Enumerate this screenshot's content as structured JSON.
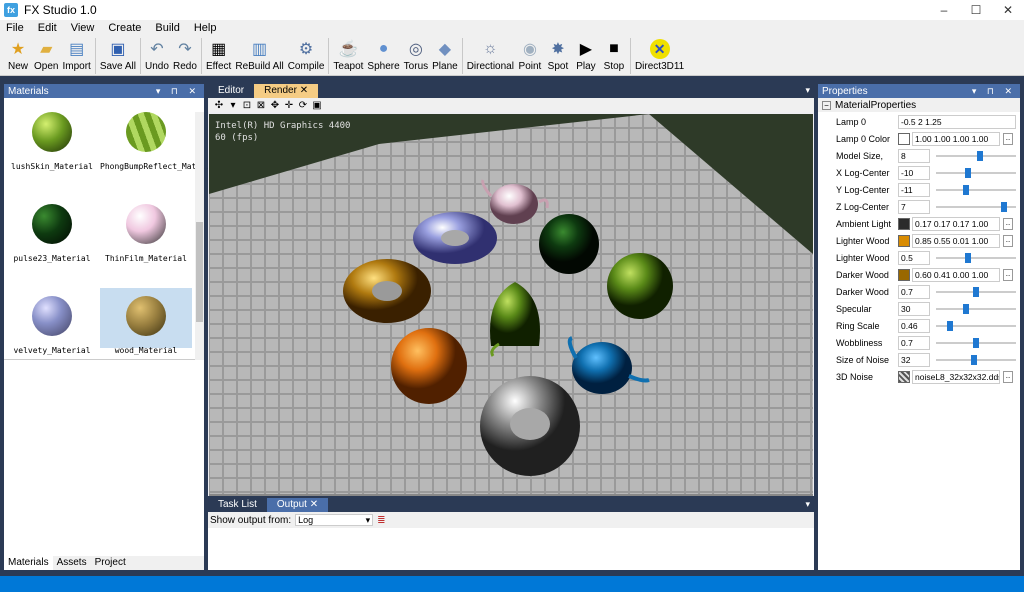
{
  "app": {
    "title": "FX Studio 1.0"
  },
  "window_controls": {
    "minimize": "–",
    "maximize": "☐",
    "close": "✕"
  },
  "menu": [
    "File",
    "Edit",
    "View",
    "Create",
    "Build",
    "Help"
  ],
  "toolbar": [
    {
      "label": "New",
      "icon": "new-icon"
    },
    {
      "label": "Open",
      "icon": "open-icon"
    },
    {
      "label": "Import",
      "icon": "import-icon"
    },
    {
      "label": "Save All",
      "icon": "save-all-icon"
    },
    {
      "label": "Undo",
      "icon": "undo-icon"
    },
    {
      "label": "Redo",
      "icon": "redo-icon"
    },
    {
      "label": "Effect",
      "icon": "effect-icon"
    },
    {
      "label": "ReBuild All",
      "icon": "rebuild-icon"
    },
    {
      "label": "Compile",
      "icon": "compile-icon"
    },
    {
      "label": "Teapot",
      "icon": "teapot-icon"
    },
    {
      "label": "Sphere",
      "icon": "sphere-icon"
    },
    {
      "label": "Torus",
      "icon": "torus-icon"
    },
    {
      "label": "Plane",
      "icon": "plane-icon"
    },
    {
      "label": "Directional",
      "icon": "directional-light-icon"
    },
    {
      "label": "Point",
      "icon": "point-light-icon"
    },
    {
      "label": "Spot",
      "icon": "spot-light-icon"
    },
    {
      "label": "Play",
      "icon": "play-icon"
    },
    {
      "label": "Stop",
      "icon": "stop-icon"
    },
    {
      "label": "Direct3D11",
      "icon": "direct3d-icon"
    }
  ],
  "materials_panel": {
    "title": "Materials",
    "items": [
      {
        "name": "lushSkin_Material",
        "color": "#6a9a20"
      },
      {
        "name": "PhongBumpReflect_Mat...",
        "color": "#8fbf3a"
      },
      {
        "name": "pulse23_Material",
        "color": "#0e3a10"
      },
      {
        "name": "ThinFilm_Material",
        "color": "#f0c8e0"
      },
      {
        "name": "velvety_Material",
        "color": "#8890c8"
      },
      {
        "name": "wood_Material",
        "color": "#9a8040"
      }
    ],
    "tabs": [
      "Materials",
      "Assets",
      "Project"
    ]
  },
  "document_tabs": [
    "Editor",
    "Render"
  ],
  "render": {
    "gpu": "Intel(R) HD Graphics 4400",
    "fps": "60 (fps)"
  },
  "output_panel": {
    "tabs": [
      "Task List",
      "Output"
    ],
    "show_from_label": "Show output from:",
    "source": "Log"
  },
  "properties_panel": {
    "title": "Properties",
    "group": "MaterialProperties",
    "rows": [
      {
        "name": "Lamp 0",
        "value": "-0.5 2 1.25",
        "kind": "text"
      },
      {
        "name": "Lamp 0 Color",
        "value": "1.00 1.00 1.00 1.00",
        "kind": "color",
        "swatch": "#ffffff"
      },
      {
        "name": "Model Size,",
        "value": "8",
        "kind": "slider",
        "level": 0.55
      },
      {
        "name": "X Log-Center",
        "value": "-10",
        "kind": "slider",
        "level": 0.4
      },
      {
        "name": "Y Log-Center",
        "value": "-11",
        "kind": "slider",
        "level": 0.38
      },
      {
        "name": "Z Log-Center",
        "value": "7",
        "kind": "slider",
        "level": 0.85
      },
      {
        "name": "Ambient Light",
        "value": "0.17 0.17 0.17 1.00",
        "kind": "color",
        "swatch": "#2b2b2b"
      },
      {
        "name": "Lighter Wood",
        "value": "0.85 0.55 0.01 1.00",
        "kind": "color",
        "swatch": "#d98c02"
      },
      {
        "name": "Lighter Wood",
        "value": "0.5",
        "kind": "slider",
        "level": 0.4
      },
      {
        "name": "Darker Wood",
        "value": "0.60 0.41 0.00 1.00",
        "kind": "color",
        "swatch": "#996800"
      },
      {
        "name": "Darker Wood",
        "value": "0.7",
        "kind": "slider",
        "level": 0.5
      },
      {
        "name": "Specular",
        "value": "30",
        "kind": "slider",
        "level": 0.38
      },
      {
        "name": "Ring Scale",
        "value": "0.46",
        "kind": "slider",
        "level": 0.18
      },
      {
        "name": "Wobbliness",
        "value": "0.7",
        "kind": "slider",
        "level": 0.5
      },
      {
        "name": "Size of Noise",
        "value": "32",
        "kind": "slider",
        "level": 0.48
      },
      {
        "name": "3D Noise",
        "value": "noiseL8_32x32x32.dds",
        "kind": "file"
      }
    ]
  }
}
